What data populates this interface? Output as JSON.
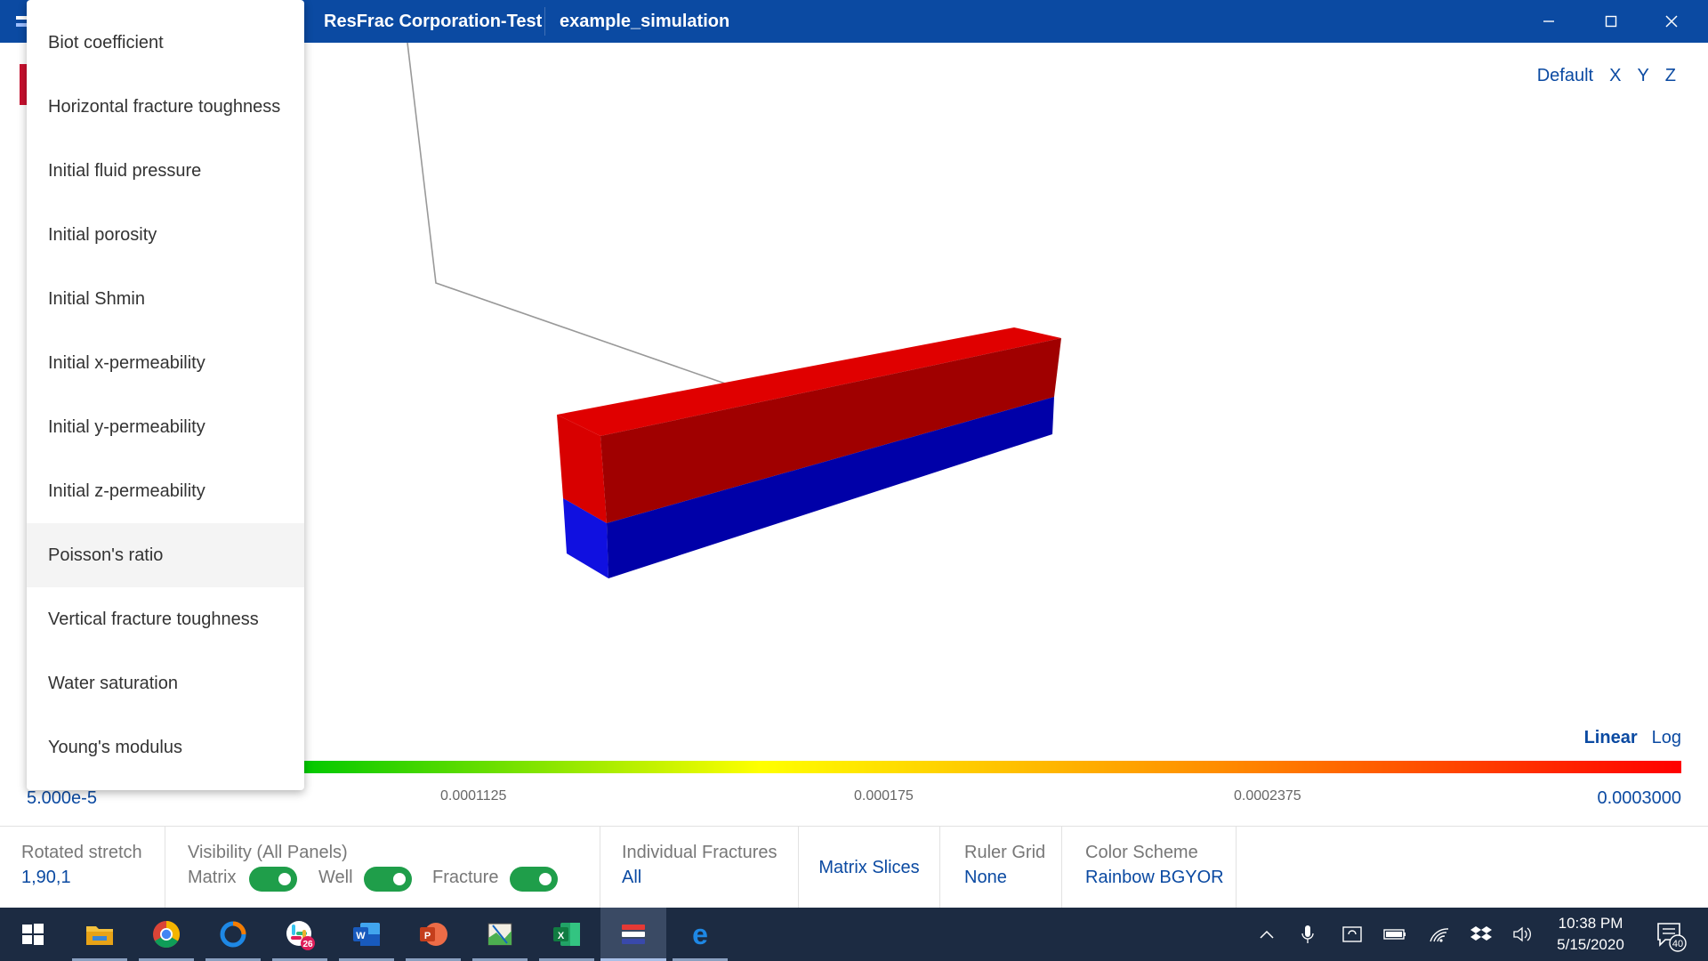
{
  "titlebar": {
    "org": "ResFrac Corporation-Test",
    "simulation": "example_simulation"
  },
  "view_controls": [
    "Default",
    "X",
    "Y",
    "Z"
  ],
  "property_menu": {
    "items": [
      "Biot coefficient",
      "Horizontal fracture toughness",
      "Initial fluid pressure",
      "Initial porosity",
      "Initial Shmin",
      "Initial x-permeability",
      "Initial y-permeability",
      "Initial z-permeability",
      "Poisson's ratio",
      "Vertical fracture toughness",
      "Water saturation",
      "Young's modulus"
    ],
    "hovered": "Poisson's ratio"
  },
  "scale": {
    "linear": "Linear",
    "log": "Log",
    "active": "Linear"
  },
  "colorbar": {
    "min": "5.000e-5",
    "ticks": [
      "0.0001125",
      "0.000175",
      "0.0002375"
    ],
    "max": "0.0003000",
    "colors": [
      "#00c800",
      "#ffff00",
      "#ff8c00",
      "#ff0000"
    ]
  },
  "model_colors": {
    "top": "#e00000",
    "front_top": "#a00000",
    "bottom": "#1010e0",
    "front_bottom": "#0000a8"
  },
  "settings": {
    "stretch_label": "Rotated stretch",
    "stretch_value": "1,90,1",
    "visibility_label": "Visibility (All Panels)",
    "matrix_label": "Matrix",
    "well_label": "Well",
    "fracture_label": "Fracture",
    "matrix_on": true,
    "well_on": true,
    "fracture_on": true,
    "fractures_label": "Individual Fractures",
    "fractures_value": "All",
    "matrix_slices": "Matrix Slices",
    "ruler_label": "Ruler Grid",
    "ruler_value": "None",
    "color_scheme_label": "Color Scheme",
    "color_scheme_value": "Rainbow BGYOR"
  },
  "taskbar": {
    "apps": [
      "start-icon",
      "file-explorer-icon",
      "chrome-icon",
      "origin-icon",
      "slack-icon",
      "word-icon",
      "powerpoint-icon",
      "maps-icon",
      "excel-icon",
      "resfrac-icon",
      "edge-icon"
    ],
    "slack_badge": "26",
    "time": "10:38 PM",
    "date": "5/15/2020",
    "notification_count": "40"
  }
}
